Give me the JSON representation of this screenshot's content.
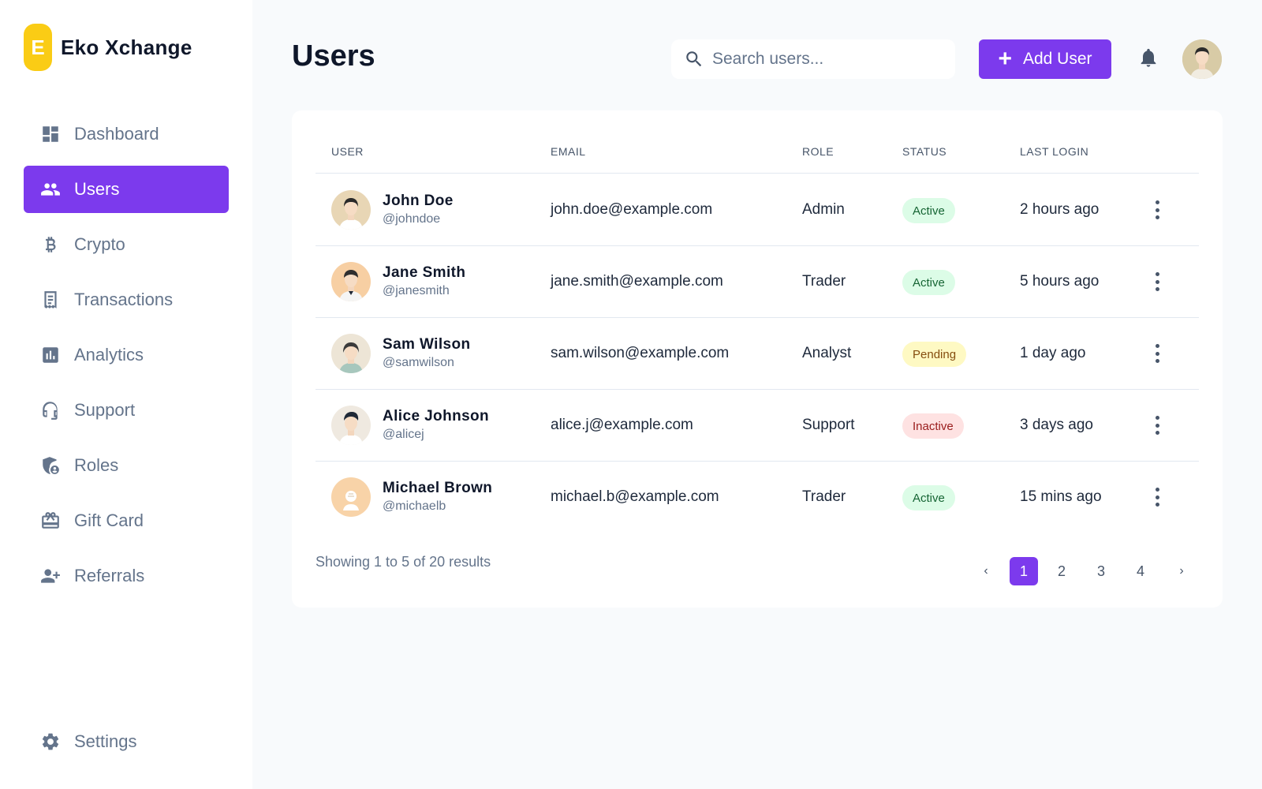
{
  "brand": {
    "logo_letter": "E",
    "name": "Eko Xchange",
    "color": "#facc15"
  },
  "accent_color": "#7c3aed",
  "sidebar": {
    "items": [
      {
        "label": "Dashboard",
        "icon": "dashboard-icon"
      },
      {
        "label": "Users",
        "icon": "users-icon",
        "active": true
      },
      {
        "label": "Crypto",
        "icon": "bitcoin-icon"
      },
      {
        "label": "Transactions",
        "icon": "receipt-icon"
      },
      {
        "label": "Analytics",
        "icon": "bar-chart-icon"
      },
      {
        "label": "Support",
        "icon": "headset-icon"
      },
      {
        "label": "Roles",
        "icon": "shield-user-icon"
      },
      {
        "label": "Gift Card",
        "icon": "gift-card-icon"
      },
      {
        "label": "Referrals",
        "icon": "user-plus-icon"
      }
    ],
    "settings": {
      "label": "Settings",
      "icon": "gear-icon"
    }
  },
  "header": {
    "title": "Users",
    "search_placeholder": "Search users...",
    "add_button_label": "Add User"
  },
  "table": {
    "columns": [
      "USER",
      "EMAIL",
      "ROLE",
      "STATUS",
      "LAST LOGIN"
    ],
    "rows": [
      {
        "name": "John Doe",
        "handle": "@johndoe",
        "email": "john.doe@example.com",
        "role": "Admin",
        "status": "Active",
        "last_login": "2 hours ago"
      },
      {
        "name": "Jane Smith",
        "handle": "@janesmith",
        "email": "jane.smith@example.com",
        "role": "Trader",
        "status": "Active",
        "last_login": "5 hours ago"
      },
      {
        "name": "Sam Wilson",
        "handle": "@samwilson",
        "email": "sam.wilson@example.com",
        "role": "Analyst",
        "status": "Pending",
        "last_login": "1 day ago"
      },
      {
        "name": "Alice Johnson",
        "handle": "@alicej",
        "email": "alice.j@example.com",
        "role": "Support",
        "status": "Inactive",
        "last_login": "3 days ago"
      },
      {
        "name": "Michael Brown",
        "handle": "@michaelb",
        "email": "michael.b@example.com",
        "role": "Trader",
        "status": "Active",
        "last_login": "15 mins ago"
      }
    ]
  },
  "status_colors": {
    "Active": "#166534",
    "Pending": "#854d0e",
    "Inactive": "#991b1b"
  },
  "footer": {
    "results_text": "Showing 1 to 5 of 20 results",
    "pages": [
      "1",
      "2",
      "3",
      "4"
    ],
    "current_page": "1",
    "prev": "‹",
    "next": "›"
  }
}
